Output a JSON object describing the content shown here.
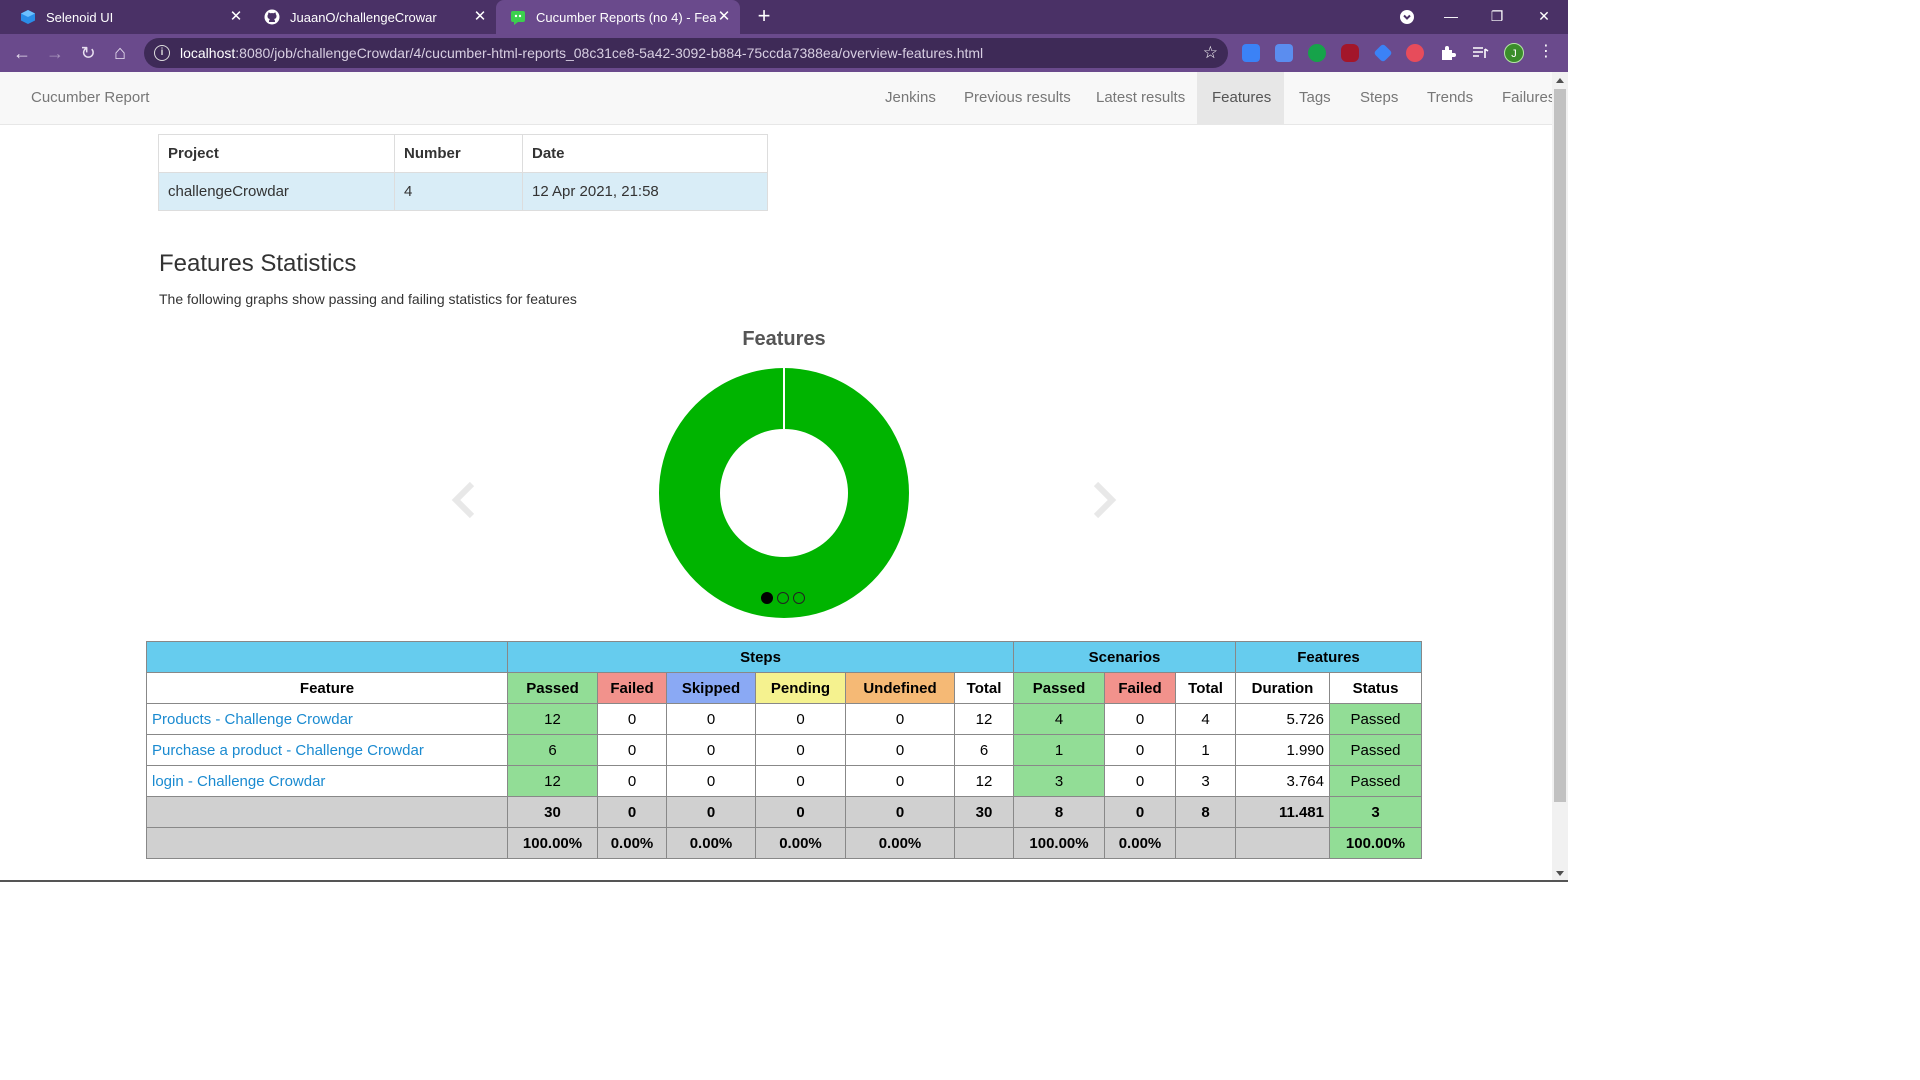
{
  "browser": {
    "tabs": [
      {
        "title": "Selenoid UI",
        "icon": "selenoid-icon"
      },
      {
        "title": "JuaanO/challengeCrowar",
        "icon": "github-icon"
      },
      {
        "title": "Cucumber Reports (no 4) - Featu",
        "icon": "cucumber-icon"
      }
    ],
    "url_host": "localhost",
    "url_path": ":8080/job/challengeCrowdar/4/cucumber-html-reports_08c31ce8-5a42-3092-b884-75ccda7388ea/overview-features.html",
    "profile_initial": "J",
    "tab_close_glyph": "✕",
    "new_tab_glyph": "+",
    "star_glyph": "☆",
    "info_glyph": "i",
    "menu_glyph": "⋮",
    "back_glyph": "←",
    "forward_glyph": "→",
    "reload_glyph": "↻",
    "home_glyph": "⌂",
    "minimize_glyph": "—",
    "restore_glyph": "❐",
    "close_glyph": "✕"
  },
  "navbar": {
    "brand": "Cucumber Report",
    "items": [
      "Jenkins",
      "Previous results",
      "Latest results",
      "Features",
      "Tags",
      "Steps",
      "Trends",
      "Failures"
    ],
    "active": "Features"
  },
  "build_info": {
    "headers": [
      "Project",
      "Number",
      "Date"
    ],
    "values": [
      "challengeCrowdar",
      "4",
      "12 Apr 2021, 21:58"
    ]
  },
  "section": {
    "title": "Features Statistics",
    "description": "The following graphs show passing and failing statistics for features"
  },
  "chart_data": {
    "type": "pie",
    "title": "Features",
    "categories": [
      "Passed",
      "Failed",
      "Skipped",
      "Pending",
      "Undefined"
    ],
    "values": [
      3,
      0,
      0,
      0,
      0
    ],
    "colors": [
      "#00b400",
      "#f2928c",
      "#8aa9f4",
      "#f5f28f",
      "#f5b975"
    ],
    "donut": true,
    "carousel_page": 1,
    "carousel_total": 3
  },
  "stats": {
    "group_headers": {
      "steps": "Steps",
      "scenarios": "Scenarios",
      "features": "Features"
    },
    "columns": {
      "feature": "Feature",
      "steps": [
        "Passed",
        "Failed",
        "Skipped",
        "Pending",
        "Undefined",
        "Total"
      ],
      "scenarios": [
        "Passed",
        "Failed",
        "Total"
      ],
      "features": [
        "Duration",
        "Status"
      ]
    },
    "rows": [
      {
        "feature": "Products - Challenge Crowdar",
        "steps": [
          "12",
          "0",
          "0",
          "0",
          "0",
          "12"
        ],
        "scenarios": [
          "4",
          "0",
          "4"
        ],
        "duration": "5.726",
        "status": "Passed"
      },
      {
        "feature": "Purchase a product - Challenge Crowdar",
        "steps": [
          "6",
          "0",
          "0",
          "0",
          "0",
          "6"
        ],
        "scenarios": [
          "1",
          "0",
          "1"
        ],
        "duration": "1.990",
        "status": "Passed"
      },
      {
        "feature": "login - Challenge Crowdar",
        "steps": [
          "12",
          "0",
          "0",
          "0",
          "0",
          "12"
        ],
        "scenarios": [
          "3",
          "0",
          "3"
        ],
        "duration": "3.764",
        "status": "Passed"
      }
    ],
    "totals": {
      "steps": [
        "30",
        "0",
        "0",
        "0",
        "0",
        "30"
      ],
      "scenarios": [
        "8",
        "0",
        "8"
      ],
      "duration": "11.481",
      "status": "3"
    },
    "percentages": {
      "steps": [
        "100.00%",
        "0.00%",
        "0.00%",
        "0.00%",
        "0.00%",
        ""
      ],
      "scenarios": [
        "100.00%",
        "0.00%",
        ""
      ],
      "duration": "",
      "status": "100.00%"
    }
  }
}
